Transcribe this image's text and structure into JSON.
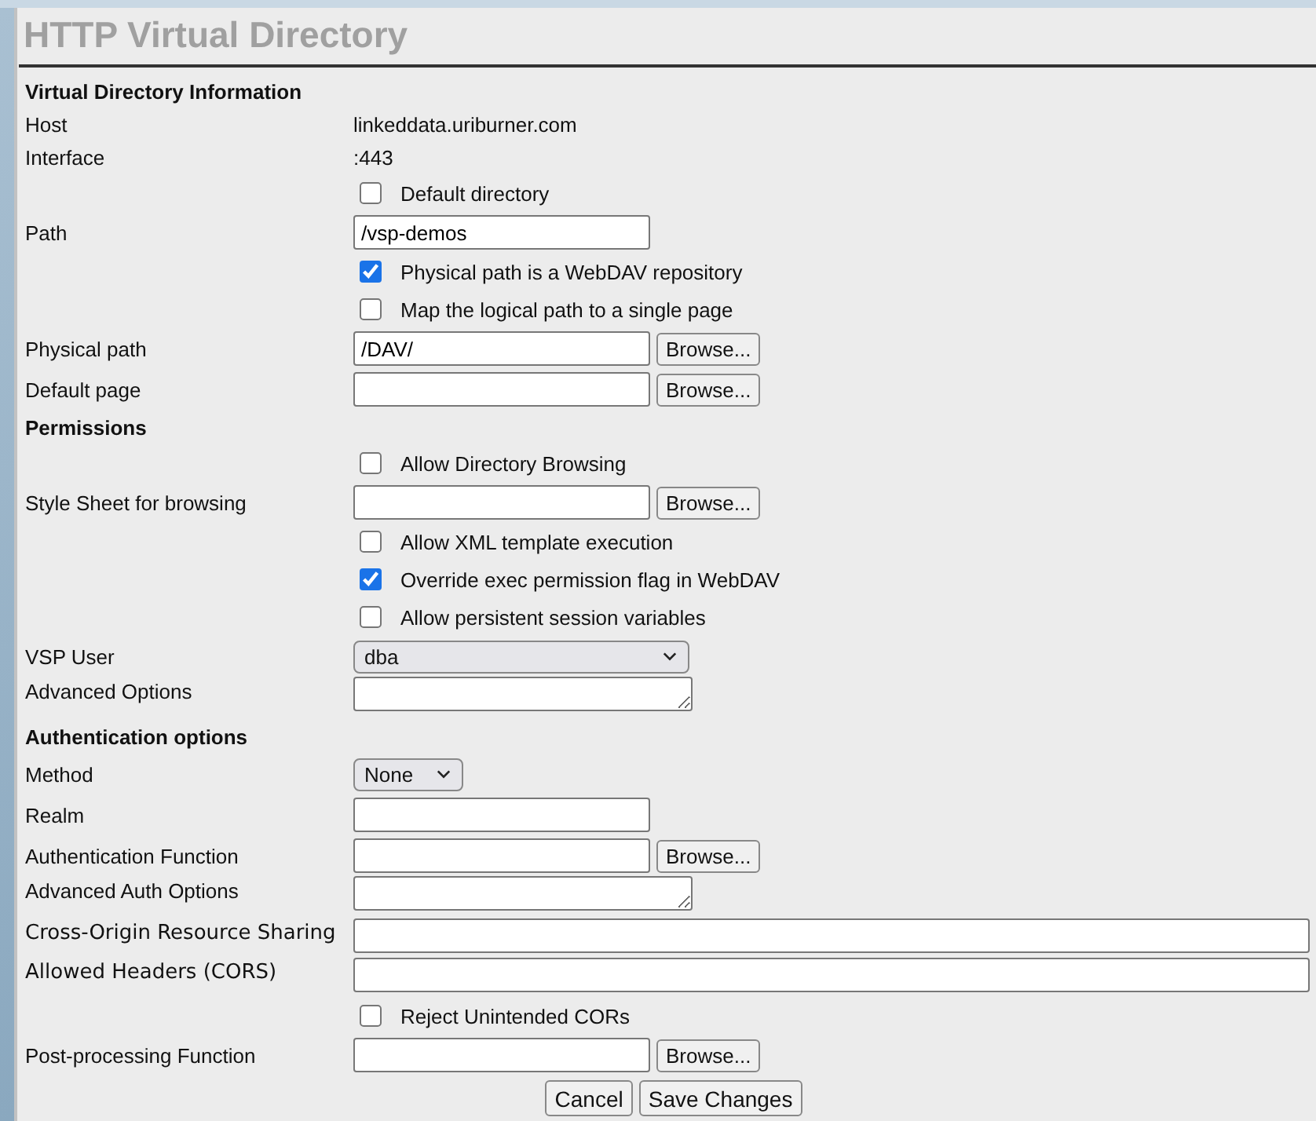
{
  "title": "HTTP Virtual Directory",
  "rows": [
    {
      "kind": "heading",
      "label": "Virtual Directory Information"
    },
    {
      "kind": "text",
      "label": "Host",
      "value": "linkeddata.uriburner.com"
    },
    {
      "kind": "text",
      "label": "Interface",
      "value": ":443"
    },
    {
      "kind": "checkbox",
      "text": "Default directory",
      "checked": false
    },
    {
      "kind": "input",
      "label": "Path",
      "value": "/vsp-demos"
    },
    {
      "kind": "checkbox",
      "text": "Physical path is a WebDAV repository",
      "checked": true
    },
    {
      "kind": "checkbox",
      "text": "Map the logical path to a single page",
      "checked": false
    },
    {
      "kind": "input",
      "label": "Physical path",
      "value": "/DAV/",
      "browse": "Browse..."
    },
    {
      "kind": "input",
      "label": "Default page",
      "browse": "Browse..."
    },
    {
      "kind": "heading",
      "label": "Permissions"
    },
    {
      "kind": "checkbox",
      "text": "Allow Directory Browsing",
      "checked": false
    },
    {
      "kind": "input",
      "label": "Style Sheet for browsing",
      "browse": "Browse..."
    },
    {
      "kind": "checkbox",
      "text": "Allow XML template execution",
      "checked": false
    },
    {
      "kind": "checkbox",
      "text": "Override exec permission flag in WebDAV",
      "checked": true
    },
    {
      "kind": "checkbox",
      "text": "Allow persistent session variables",
      "checked": false
    },
    {
      "kind": "select",
      "label": "VSP User",
      "value": "dba",
      "wide": true
    },
    {
      "kind": "textarea",
      "label": "Advanced Options"
    },
    {
      "kind": "heading",
      "label": "Authentication options"
    },
    {
      "kind": "select",
      "label": "Method",
      "value": "None",
      "wide": false
    },
    {
      "kind": "input",
      "label": "Realm"
    },
    {
      "kind": "input",
      "label": "Authentication Function",
      "browse": "Browse..."
    },
    {
      "kind": "textarea",
      "label": "Advanced Auth Options"
    },
    {
      "kind": "wide",
      "label": "Cross-Origin Resource Sharing"
    },
    {
      "kind": "wide",
      "label": "Allowed Headers (CORS)"
    },
    {
      "kind": "checkbox",
      "text": "Reject Unintended CORs",
      "checked": false
    },
    {
      "kind": "input",
      "label": "Post-processing Function",
      "browse": "Browse..."
    }
  ],
  "buttons": [
    "Cancel",
    "Save Changes"
  ]
}
